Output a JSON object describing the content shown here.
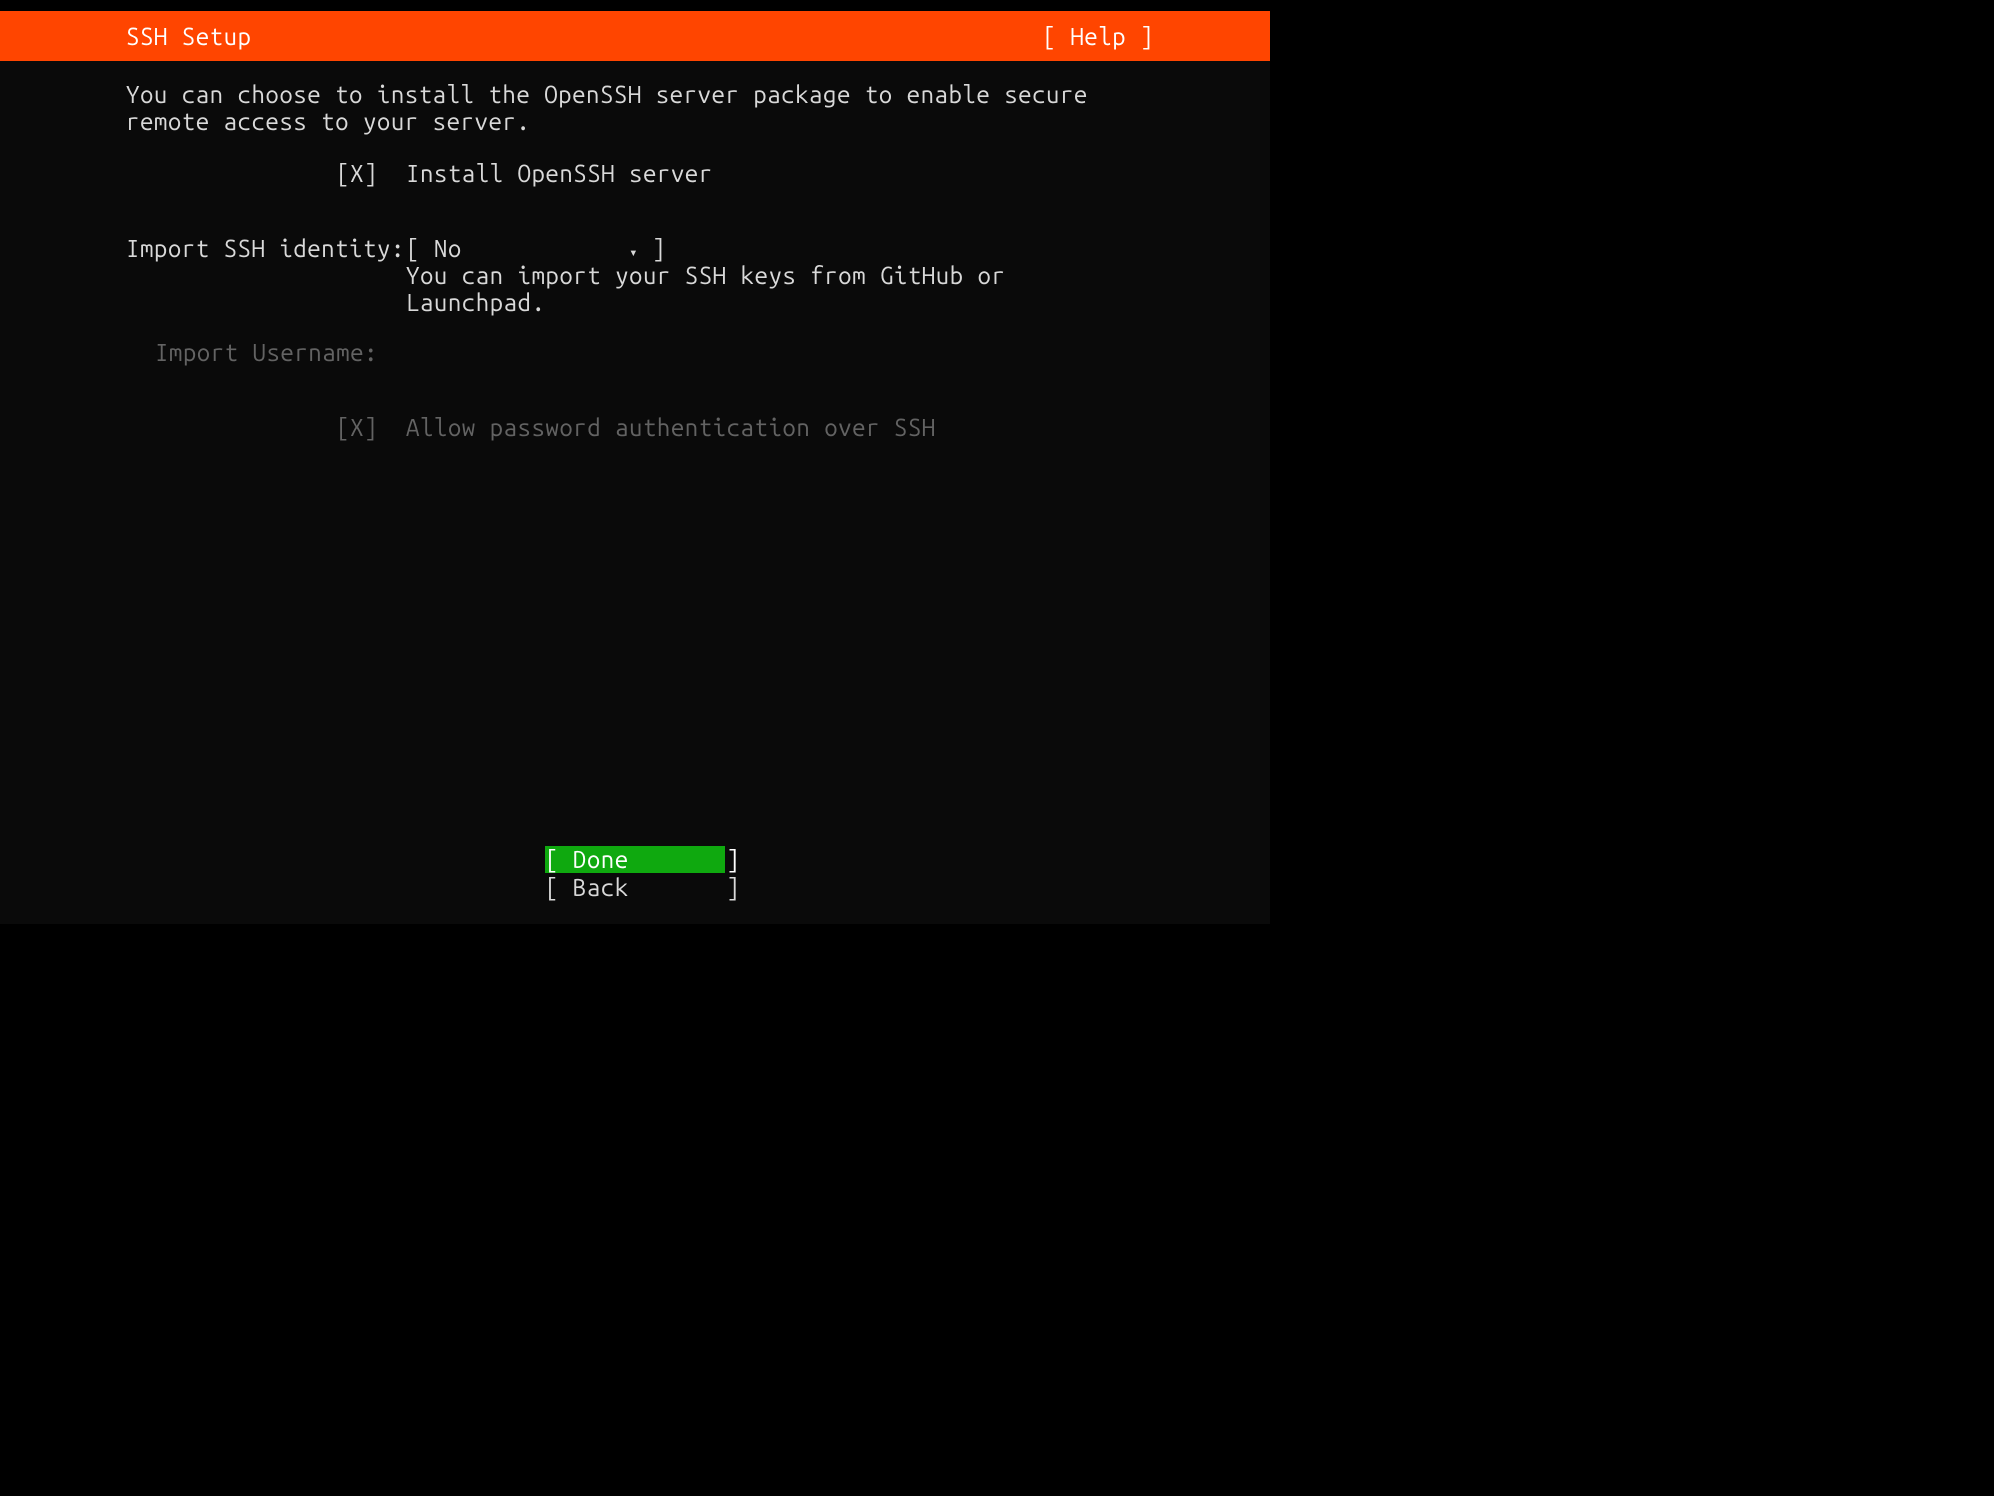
{
  "header": {
    "title": "SSH Setup",
    "help": "[ Help ]"
  },
  "intro": "You can choose to install the OpenSSH server package to enable secure remote access to your server.",
  "install_openssh": {
    "checkbox": "[X]",
    "label": "Install OpenSSH server"
  },
  "import_identity": {
    "label": "Import SSH identity:",
    "value_open": "[ ",
    "value": "No",
    "value_close": " ]",
    "arrow": "▾",
    "help": "You can import your SSH keys from GitHub or Launchpad."
  },
  "import_username": {
    "label": "Import Username:",
    "value": ""
  },
  "allow_pwauth": {
    "checkbox": "[X]",
    "label": "Allow password authentication over SSH"
  },
  "buttons": {
    "done": "[ Done       ]",
    "back": "[ Back       ]"
  }
}
